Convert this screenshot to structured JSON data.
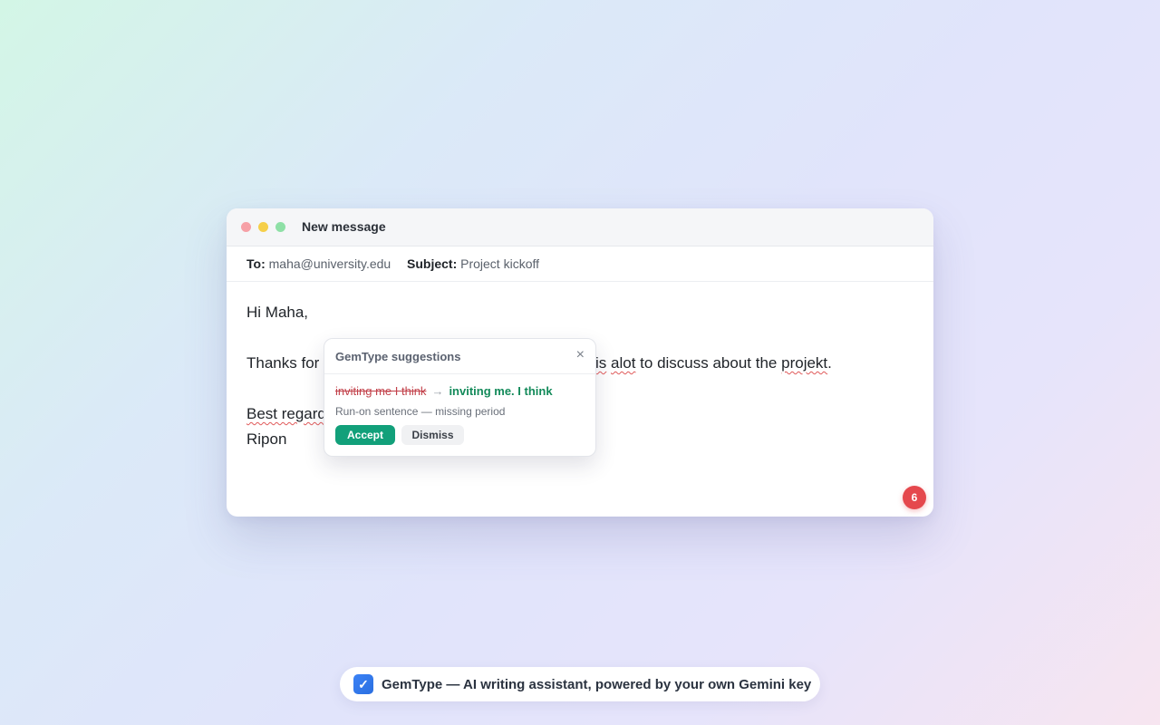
{
  "window": {
    "title": "New message",
    "to_label": "To:",
    "to_value": "maha@university.edu",
    "subject_label": "Subject:",
    "subject_value": "Project kickoff"
  },
  "email": {
    "greeting": "Hi Maha,",
    "line1_start": "Thanks for",
    "line1_word_is": "is",
    "line1_word_alot": "alot",
    "line1_mid": "to discuss about the",
    "line1_word_projekt": "projekt",
    "line1_end": ".",
    "closing": "Best regard",
    "signature": "Ripon"
  },
  "issue_count": "6",
  "popup": {
    "title": "GemType suggestions",
    "close_glyph": "×",
    "original": "inviting me I think",
    "arrow": "→",
    "replacement": "inviting me. I think",
    "reason": "Run-on sentence — missing period",
    "accept_label": "Accept",
    "dismiss_label": "Dismiss"
  },
  "footer": {
    "check_glyph": "✓",
    "text": "GemType — AI writing assistant, powered by your own Gemini key"
  }
}
